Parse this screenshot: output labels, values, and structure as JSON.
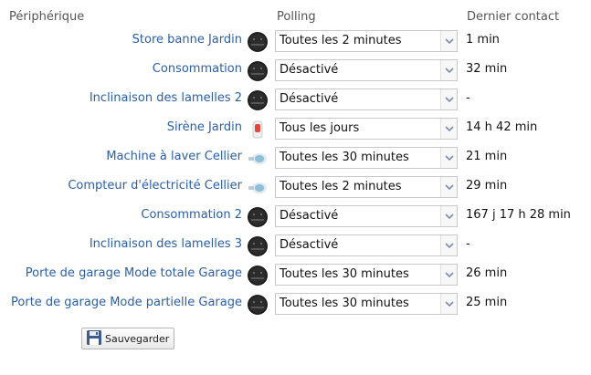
{
  "headers": {
    "device": "Périphérique",
    "polling": "Polling",
    "last_contact": "Dernier contact"
  },
  "rows": [
    {
      "name": "Store banne Jardin",
      "icon": "module-icon",
      "polling": "Toutes les 2 minutes",
      "last": "1 min"
    },
    {
      "name": "Consommation",
      "icon": "module-icon",
      "polling": "Désactivé",
      "last": "32 min"
    },
    {
      "name": "Inclinaison des lamelles 2",
      "icon": "module-icon",
      "polling": "Désactivé",
      "last": "-"
    },
    {
      "name": "Sirène Jardin",
      "icon": "siren-icon",
      "polling": "Tous les jours",
      "last": "14 h 42 min"
    },
    {
      "name": "Machine à laver Cellier",
      "icon": "plug-icon",
      "polling": "Toutes les 30 minutes",
      "last": "21 min"
    },
    {
      "name": "Compteur d'électricité Cellier",
      "icon": "plug-icon",
      "polling": "Toutes les 2 minutes",
      "last": "29 min"
    },
    {
      "name": "Consommation 2",
      "icon": "module-icon",
      "polling": "Désactivé",
      "last": "167 j 17 h 28 min"
    },
    {
      "name": "Inclinaison des lamelles 3",
      "icon": "module-icon",
      "polling": "Désactivé",
      "last": "-"
    },
    {
      "name": "Porte de garage Mode totale Garage",
      "icon": "module-icon",
      "polling": "Toutes les 30 minutes",
      "last": "26 min"
    },
    {
      "name": "Porte de garage Mode partielle Garage",
      "icon": "module-icon",
      "polling": "Toutes les 30 minutes",
      "last": "25 min"
    }
  ],
  "save_button": {
    "label": "Sauvegarder",
    "icon": "floppy-disk-icon"
  },
  "colors": {
    "link": "#2a5fa8",
    "header": "#555555"
  }
}
